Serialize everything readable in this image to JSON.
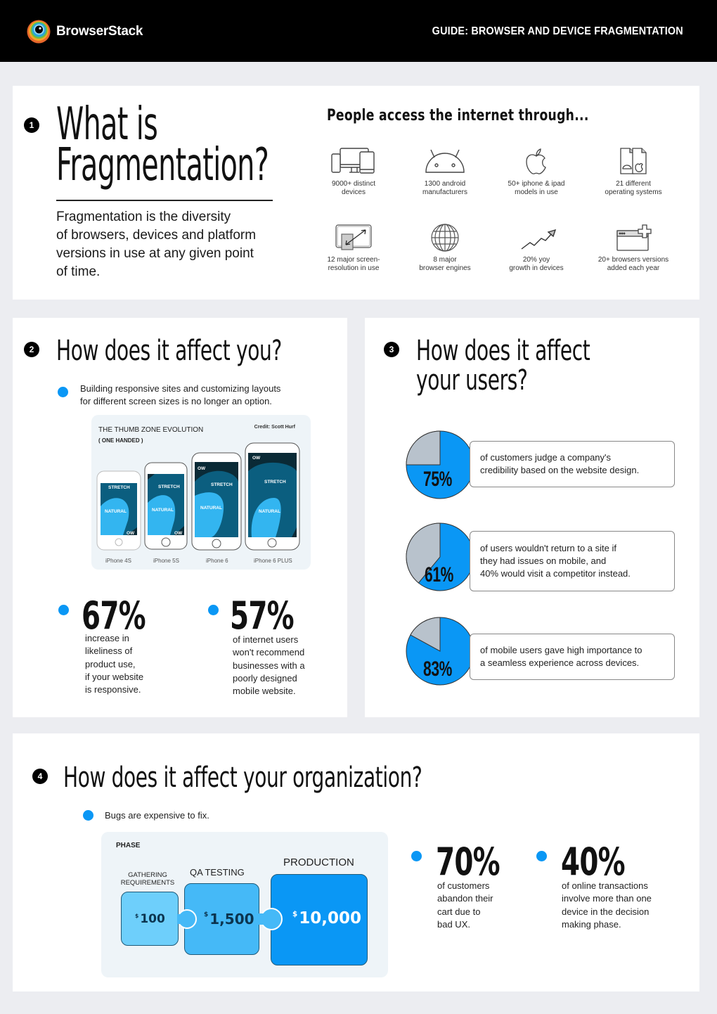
{
  "header": {
    "brand": "BrowserStack",
    "guide_prefix": "GUIDE",
    "guide_title": "BROWSER AND DEVICE FRAGMENTATION",
    "guide_full": "GUIDE: BROWSER AND DEVICE FRAGMENTATION"
  },
  "section1": {
    "number": "1",
    "title_line1": "What is",
    "title_line2": "Fragmentation?",
    "description_lines": [
      "Fragmentation is the diversity",
      "of browsers, devices and platform",
      "versions in use at any given point",
      "of time."
    ],
    "subheading": "People access the internet through...",
    "stats": [
      {
        "icon": "devices-icon",
        "line1": "9000+ distinct",
        "line2": "devices"
      },
      {
        "icon": "android-icon",
        "line1": "1300 android",
        "line2": "manufacturers"
      },
      {
        "icon": "apple-icon",
        "line1": "50+ iphone & ipad",
        "line2": "models in use"
      },
      {
        "icon": "operating-systems-icon",
        "line1": "21 different",
        "line2": "operating systems"
      },
      {
        "icon": "screen-resolution-icon",
        "line1": "12 major screen-",
        "line2": "resolution in use"
      },
      {
        "icon": "globe-icon",
        "line1": "8 major",
        "line2": "browser engines"
      },
      {
        "icon": "growth-chart-icon",
        "line1": "20% yoy",
        "line2": "growth in devices"
      },
      {
        "icon": "browser-add-icon",
        "line1": "20+ browsers versions",
        "line2": "added each year"
      }
    ]
  },
  "section2": {
    "number": "2",
    "title": "How does it affect you?",
    "bullet_line1": "Building responsive sites and customizing layouts",
    "bullet_line2": "for different screen sizes is no longer an option.",
    "thumb_zone": {
      "title": "THE THUMB ZONE EVOLUTION",
      "subtitle": "( ONE HANDED )",
      "credit": "Credit: Scott Hurf",
      "zone_labels": {
        "ow": "OW",
        "stretch": "STRETCH",
        "natural": "NATURAL"
      },
      "phones": [
        "iPhone 4S",
        "iPhone 5S",
        "iPhone 6",
        "iPhone 6 PLUS"
      ]
    },
    "stats": [
      {
        "value": "67%",
        "lines": [
          "increase in",
          "likeliness of",
          "product use,",
          "if your website",
          "is responsive."
        ]
      },
      {
        "value": "57%",
        "lines": [
          "of internet users",
          "won't recommend",
          "businesses with a",
          "poorly designed",
          "mobile website."
        ]
      }
    ]
  },
  "section3": {
    "number": "3",
    "title_line1": "How does it affect",
    "title_line2": "your users?",
    "pies": [
      {
        "label": "75%",
        "percent": 75,
        "lines": [
          "of customers judge a company's",
          "credibility based on the website design."
        ]
      },
      {
        "label": "61%",
        "percent": 61,
        "lines": [
          "of users wouldn't return to a site if",
          "they had issues on mobile, and",
          "40% would visit a competitor instead."
        ]
      },
      {
        "label": "83%",
        "percent": 83,
        "lines": [
          "of mobile users gave high importance to",
          "a seamless experience across devices."
        ]
      }
    ],
    "colors": {
      "filled": "#0a97f5",
      "remainder": "#b8c2cc"
    }
  },
  "section4": {
    "number": "4",
    "title": "How does it affect your organization?",
    "bullet": "Bugs are expensive to fix.",
    "phase": {
      "heading": "PHASE",
      "steps": [
        {
          "name_line1": "GATHERING",
          "name_line2": "REQUIREMENTS",
          "currency": "$",
          "amount": "100",
          "color": "#6ecffb"
        },
        {
          "name_line1": "QA TESTING",
          "name_line2": "",
          "currency": "$",
          "amount": "1,500",
          "color": "#45b9f7"
        },
        {
          "name_line1": "PRODUCTION",
          "name_line2": "",
          "currency": "$",
          "amount": "10,000",
          "color": "#0a97f5"
        }
      ]
    },
    "stats": [
      {
        "value": "70%",
        "lines": [
          "of customers",
          "abandon their",
          "cart due to",
          "bad UX."
        ]
      },
      {
        "value": "40%",
        "lines": [
          "of online transactions",
          "involve more than one",
          "device in the decision",
          "making phase."
        ]
      }
    ]
  },
  "colors": {
    "accent": "#0a97f5",
    "background": "#ecedf1",
    "header": "#000000"
  }
}
